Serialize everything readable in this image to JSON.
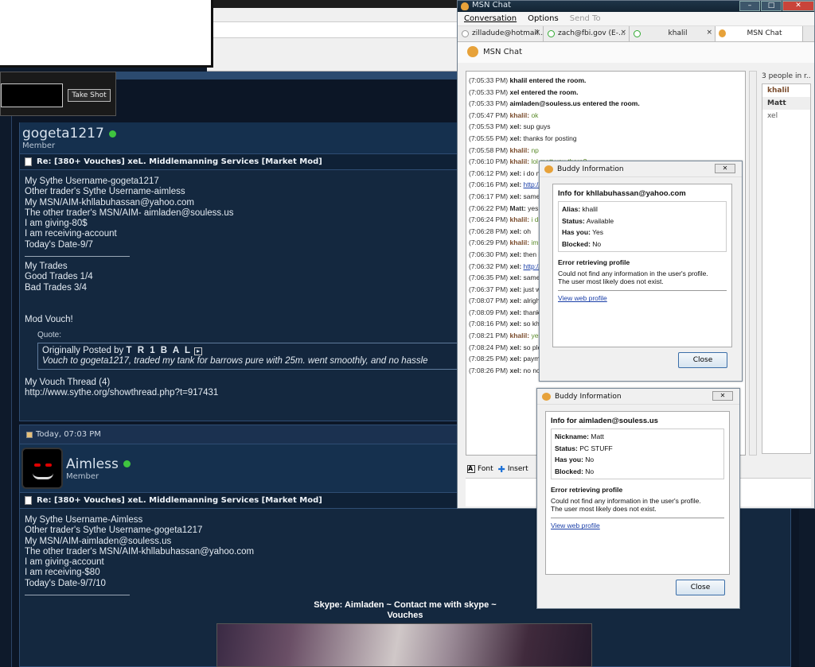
{
  "takeshot": {
    "button_label": "Take Shot"
  },
  "post1": {
    "username": "gogeta1217",
    "rank": "Member",
    "title": "Re: [380+ Vouches] xeL. Middlemanning Services [Market Mod]",
    "lines": [
      "My Sythe Username-gogeta1217",
      "Other trader's Sythe Username-aimless",
      "My MSN/AIM-khllabuhassan@yahoo.com",
      "The other trader's MSN/AIM- aimladen@souless.us",
      "I am giving-80$",
      "I am receiving-account",
      "Today's Date-9/7"
    ],
    "trades_header": "My Trades",
    "good_trades": "Good Trades 1/4",
    "bad_trades": "Bad Trades 3/4",
    "mod_vouch": "Mod Vouch!",
    "quote_label": "Quote:",
    "quote_by_prefix": "Originally Posted by",
    "quote_author": "T R 1 B A L",
    "quote_text": "Vouch to gogeta1217, traded my tank for barrows pure with 25m. went smoothly, and no hassle",
    "vouch_thread": "My Vouch Thread (4)",
    "vouch_url": "http://www.sythe.org/showthread.php?t=917431"
  },
  "post2": {
    "date": "Today, 07:03 PM",
    "username": "Aimless",
    "rank": "Member",
    "title": "Re: [380+ Vouches] xeL. Middlemanning Services [Market Mod]",
    "lines": [
      "My Sythe Username-Aimless",
      "Other trader's Sythe Username-gogeta1217",
      "My MSN/AIM-aimladen@souless.us",
      "The other trader's MSN/AIM-khllabuhassan@yahoo.com",
      "I am giving-account",
      "I am receiving-$80",
      "Today's Date-9/7/10"
    ],
    "sig_line1": "Skype: Aimladen ~ Contact me with skype ~",
    "sig_line2": "Vouches"
  },
  "msn": {
    "window_title": "MSN Chat",
    "menu": {
      "conversation": "Conversation",
      "options": "Options",
      "send_to": "Send To"
    },
    "tabs": [
      {
        "label": "zilladude@hotmail..."
      },
      {
        "label": "zach@fbi.gov (E-..."
      },
      {
        "label": "khalil"
      },
      {
        "label": "MSN Chat"
      }
    ],
    "sub_title": "MSN Chat",
    "people_header": "3 people in r...",
    "people": [
      "khalil",
      "Matt",
      "xel"
    ],
    "toolbar": {
      "font": "Font",
      "insert": "Insert"
    },
    "chat": [
      {
        "ts": "(7:05:33 PM)",
        "sys": "khalil entered the room."
      },
      {
        "ts": "(7:05:33 PM)",
        "sys": "xel entered the room."
      },
      {
        "ts": "(7:05:33 PM)",
        "sys": "aimladen@souless.us entered the room."
      },
      {
        "ts": "(7:05:47 PM)",
        "who": "khalil:",
        "msg": "ok"
      },
      {
        "ts": "(7:05:53 PM)",
        "who": "xel:",
        "msg": "sup guys"
      },
      {
        "ts": "(7:05:55 PM)",
        "who": "xel:",
        "msg": "thanks for posting"
      },
      {
        "ts": "(7:05:58 PM)",
        "who": "khalil:",
        "msg": "np"
      },
      {
        "ts": "(7:06:10 PM)",
        "who": "khalil:",
        "msg": "lol matt you there?"
      },
      {
        "ts": "(7:06:12 PM)",
        "who": "xel:",
        "msg": "i do ne"
      },
      {
        "ts": "(7:06:16 PM)",
        "who": "xel:",
        "link": "http://"
      },
      {
        "ts": "(7:06:17 PM)",
        "who": "xel:",
        "msg": "same f"
      },
      {
        "ts": "(7:06:22 PM)",
        "who": "Matt:",
        "msg": "yes"
      },
      {
        "ts": "(7:06:24 PM)",
        "who": "khalil:",
        "msg": "i did"
      },
      {
        "ts": "(7:06:28 PM)",
        "who": "xel:",
        "msg": "oh"
      },
      {
        "ts": "(7:06:29 PM)",
        "who": "khalil:",
        "msg": "im g"
      },
      {
        "ts": "(7:06:30 PM)",
        "who": "xel:",
        "msg": "then i"
      },
      {
        "ts": "(7:06:32 PM)",
        "who": "xel:",
        "link": "http://"
      },
      {
        "ts": "(7:06:35 PM)",
        "who": "xel:",
        "msg": "same f"
      },
      {
        "ts": "(7:06:37 PM)",
        "who": "xel:",
        "msg": "just wi"
      },
      {
        "ts": "(7:08:07 PM)",
        "who": "xel:",
        "msg": "alright"
      },
      {
        "ts": "(7:08:09 PM)",
        "who": "xel:",
        "msg": "thanks"
      },
      {
        "ts": "(7:08:16 PM)",
        "who": "xel:",
        "msg": "so kha"
      },
      {
        "ts": "(7:08:21 PM)",
        "who": "khalil:",
        "msg": "yes"
      },
      {
        "ts": "(7:08:24 PM)",
        "who": "xel:",
        "msg": "so plea"
      },
      {
        "ts": "(7:08:25 PM)",
        "who": "xel:",
        "msg": "payme"
      },
      {
        "ts": "(7:08:26 PM)",
        "who": "xel:",
        "msg": "no not"
      }
    ]
  },
  "buddy1": {
    "title": "Buddy Information",
    "header": "Info for khllabuhassan@yahoo.com",
    "f1_label": "Alias:",
    "f1_value": "khalil",
    "f2_label": "Status:",
    "f2_value": "Available",
    "f3_label": "Has you:",
    "f3_value": "Yes",
    "f4_label": "Blocked:",
    "f4_value": "No",
    "error_title": "Error retrieving profile",
    "error_text1": "Could not find any information in the user's profile.",
    "error_text2": "The user most likely does not exist.",
    "link": "View web profile",
    "close": "Close"
  },
  "buddy2": {
    "title": "Buddy Information",
    "header": "Info for aimladen@souless.us",
    "f1_label": "Nickname:",
    "f1_value": "Matt",
    "f2_label": "Status:",
    "f2_value": "PC STUFF",
    "f3_label": "Has you:",
    "f3_value": "No",
    "f4_label": "Blocked:",
    "f4_value": "No",
    "error_title": "Error retrieving profile",
    "error_text1": "Could not find any information in the user's profile.",
    "error_text2": "The user most likely does not exist.",
    "link": "View web profile",
    "close": "Close"
  }
}
